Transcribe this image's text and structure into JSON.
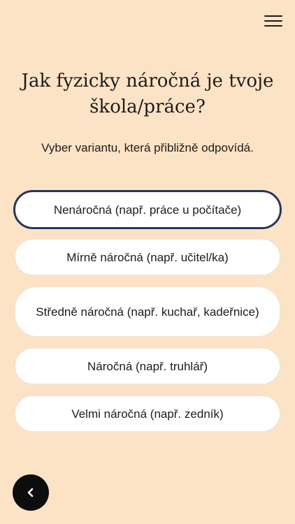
{
  "header": {
    "menu_icon": "hamburger-menu-icon"
  },
  "question": {
    "title": "Jak fyzicky náročná je tvoje škola/práce?",
    "subtitle": "Vyber variantu, která přibližně odpovídá."
  },
  "options": [
    {
      "label": "Nenáročná (např. práce u počítače)",
      "selected": true
    },
    {
      "label": "Mírně náročná (např. učitel/ka)",
      "selected": false
    },
    {
      "label": "Středně náročná (např. kuchař, kadeřnice)",
      "selected": false
    },
    {
      "label": "Náročná (např. truhlář)",
      "selected": false
    },
    {
      "label": "Velmi náročná (např. zedník)",
      "selected": false
    }
  ],
  "footer": {
    "back_icon": "chevron-left-icon"
  },
  "colors": {
    "background": "#fde3c6",
    "selected_border": "#28365a",
    "option_background": "#ffffff",
    "back_button": "#0d0d0d"
  }
}
